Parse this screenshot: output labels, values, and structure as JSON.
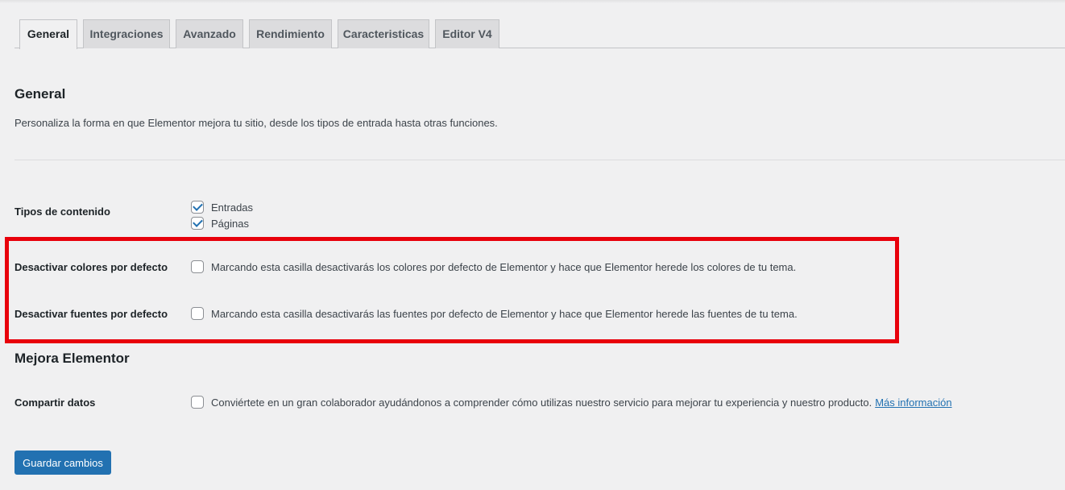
{
  "tabs": [
    {
      "label": "General",
      "active": true
    },
    {
      "label": "Integraciones",
      "active": false
    },
    {
      "label": "Avanzado",
      "active": false
    },
    {
      "label": "Rendimiento",
      "active": false
    },
    {
      "label": "Caracteristicas",
      "active": false
    },
    {
      "label": "Editor V4",
      "active": false
    }
  ],
  "general": {
    "title": "General",
    "description": "Personaliza la forma en que Elementor mejora tu sitio, desde los tipos de entrada hasta otras funciones."
  },
  "content_types": {
    "label": "Tipos de contenido",
    "options": [
      {
        "label": "Entradas",
        "checked": true
      },
      {
        "label": "Páginas",
        "checked": true
      }
    ]
  },
  "disable_colors": {
    "label": "Desactivar colores por defecto",
    "checked": false,
    "text": "Marcando esta casilla desactivarás los colores por defecto de Elementor y hace que Elementor herede los colores de tu tema."
  },
  "disable_fonts": {
    "label": "Desactivar fuentes por defecto",
    "checked": false,
    "text": "Marcando esta casilla desactivarás las fuentes por defecto de Elementor y hace que Elementor herede las fuentes de tu tema."
  },
  "improve": {
    "title": "Mejora Elementor",
    "share_label": "Compartir datos",
    "checked": false,
    "text": "Conviértete en un gran colaborador ayudándonos a comprender cómo utilizas nuestro servicio para mejorar tu experiencia y nuestro producto.",
    "link": "Más información"
  },
  "save_button": "Guardar cambios",
  "colors": {
    "accent": "#2271b1",
    "highlight": "#e8000b",
    "background": "#f0f0f1"
  }
}
